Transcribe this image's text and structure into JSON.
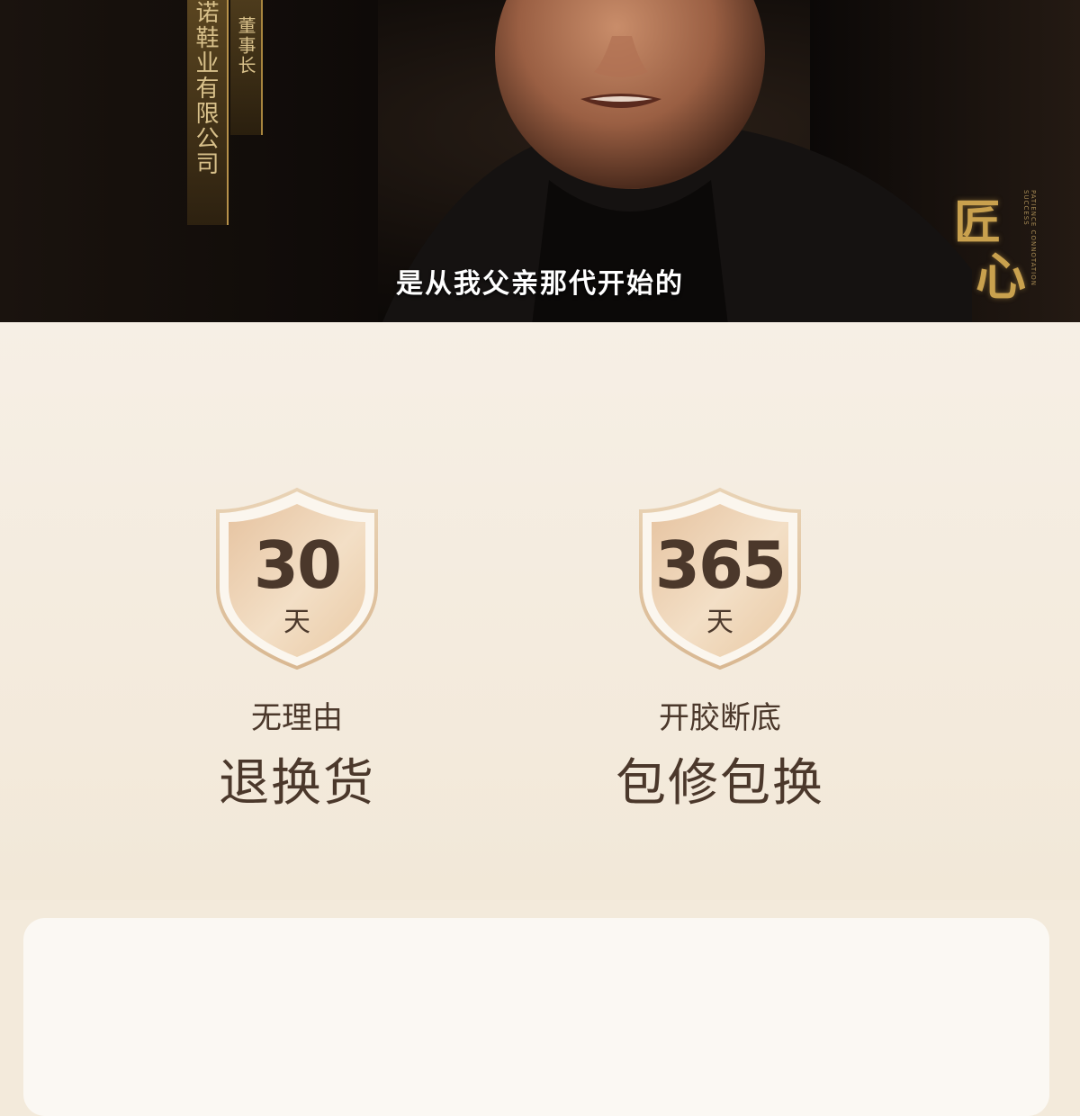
{
  "video": {
    "company": "诺鞋业有限公司",
    "title": "董事长",
    "subtitle": "是从我父亲那代开始的",
    "brand": {
      "char1": "匠",
      "char2": "心",
      "small": "PATIENCE CONNOTATION SUCCESS"
    }
  },
  "guarantees": [
    {
      "number": "30",
      "unit": "天",
      "caption_small": "无理由",
      "caption_big": "退换货"
    },
    {
      "number": "365",
      "unit": "天",
      "caption_small": "开胶断底",
      "caption_big": "包修包换"
    }
  ],
  "card": {
    "text": ""
  },
  "colors": {
    "gold": "#c9a14e",
    "brown": "#4b382b",
    "bg": "#f3eadb"
  }
}
